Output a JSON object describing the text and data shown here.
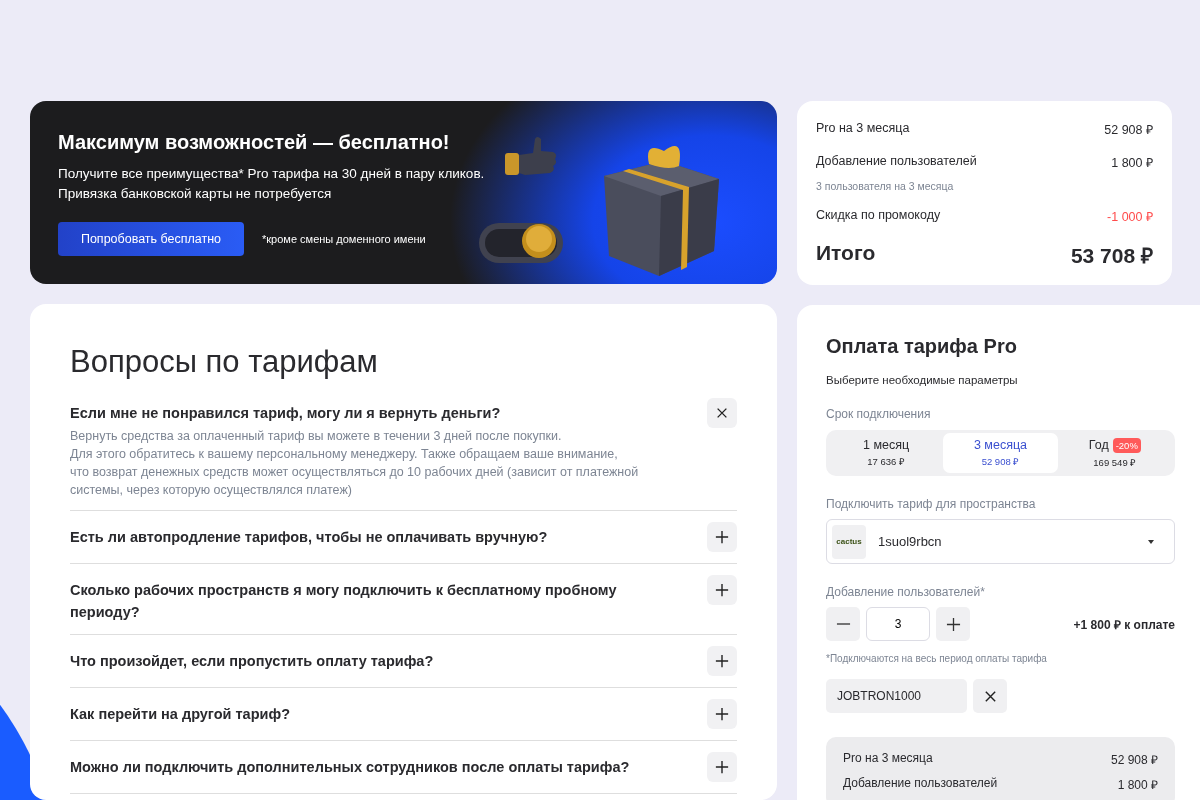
{
  "banner": {
    "title": "Максимум возможностей — бесплатно!",
    "lines": [
      "Получите все преимущества* Pro тарифа на 30 дней в пару кликов.",
      "Привязка банковской карты не потребуется"
    ],
    "button": "Попробовать бесплатно",
    "footnote": "*кроме смены доменного имени"
  },
  "summary": {
    "rows": [
      {
        "kind": "item",
        "label": "Pro на 3 месяца",
        "value": "52 908 ₽"
      },
      {
        "kind": "item",
        "label": "Добавление пользователей",
        "value": "1 800 ₽",
        "note": "3 пользователя на 3 месяца"
      },
      {
        "kind": "discount",
        "label": "Скидка по промокоду",
        "value": "-1 000 ₽"
      }
    ],
    "total_label": "Итого",
    "total_value": "53 708 ₽"
  },
  "faq": {
    "title": "Вопросы по тарифам",
    "items": [
      {
        "question": "Если мне не понравился тариф, могу ли я вернуть деньги?",
        "expanded": true,
        "answer_lines": [
          "Вернуть средства за оплаченный тариф вы можете в течении 3 дней после покупки.",
          "Для этого обратитесь к вашему персональному менеджеру. Также обращаем ваше внимание,",
          "что возврат денежных средств может осуществляться до 10 рабочих дней (зависит от платежной системы, через которую осуществлялся платеж)"
        ]
      },
      {
        "question": "Есть ли автопродление тарифов, чтобы не оплачивать вручную?",
        "expanded": false
      },
      {
        "question": "Сколько рабочих пространств я могу подключить к бесплатному пробному периоду?",
        "expanded": false
      },
      {
        "question": "Что произойдет, если пропустить оплату тарифа?",
        "expanded": false
      },
      {
        "question": "Как перейти на другой тариф?",
        "expanded": false
      },
      {
        "question": "Можно ли подключить дополнительных сотрудников после оплаты тарифа?",
        "expanded": false
      }
    ]
  },
  "payment": {
    "title": "Оплата тарифа Pro",
    "subtitle": "Выберите необходимые параметры",
    "period_label": "Срок подключения",
    "periods": [
      {
        "label": "1 месяц",
        "price": "17 636 ₽",
        "selected": false
      },
      {
        "label": "3 месяца",
        "price": "52 908 ₽",
        "selected": true
      },
      {
        "label": "Год",
        "price": "169 549 ₽",
        "badge": "-20%",
        "selected": false
      }
    ],
    "space_label": "Подключить тариф для пространства",
    "space": {
      "logo": "cactus",
      "name": "1suol9rbcn"
    },
    "users_label": "Добавление пользователей*",
    "users_value": "3",
    "users_extra": "+1 800 ₽ к оплате",
    "users_note": "*Подключаются на весь период оплаты тарифа",
    "promo": "JOBTRON1000",
    "summary_rows": [
      {
        "label": "Pro на 3 месяца",
        "value": "52 908 ₽"
      },
      {
        "label": "Добавление пользователей",
        "value": "1 800 ₽"
      }
    ]
  }
}
